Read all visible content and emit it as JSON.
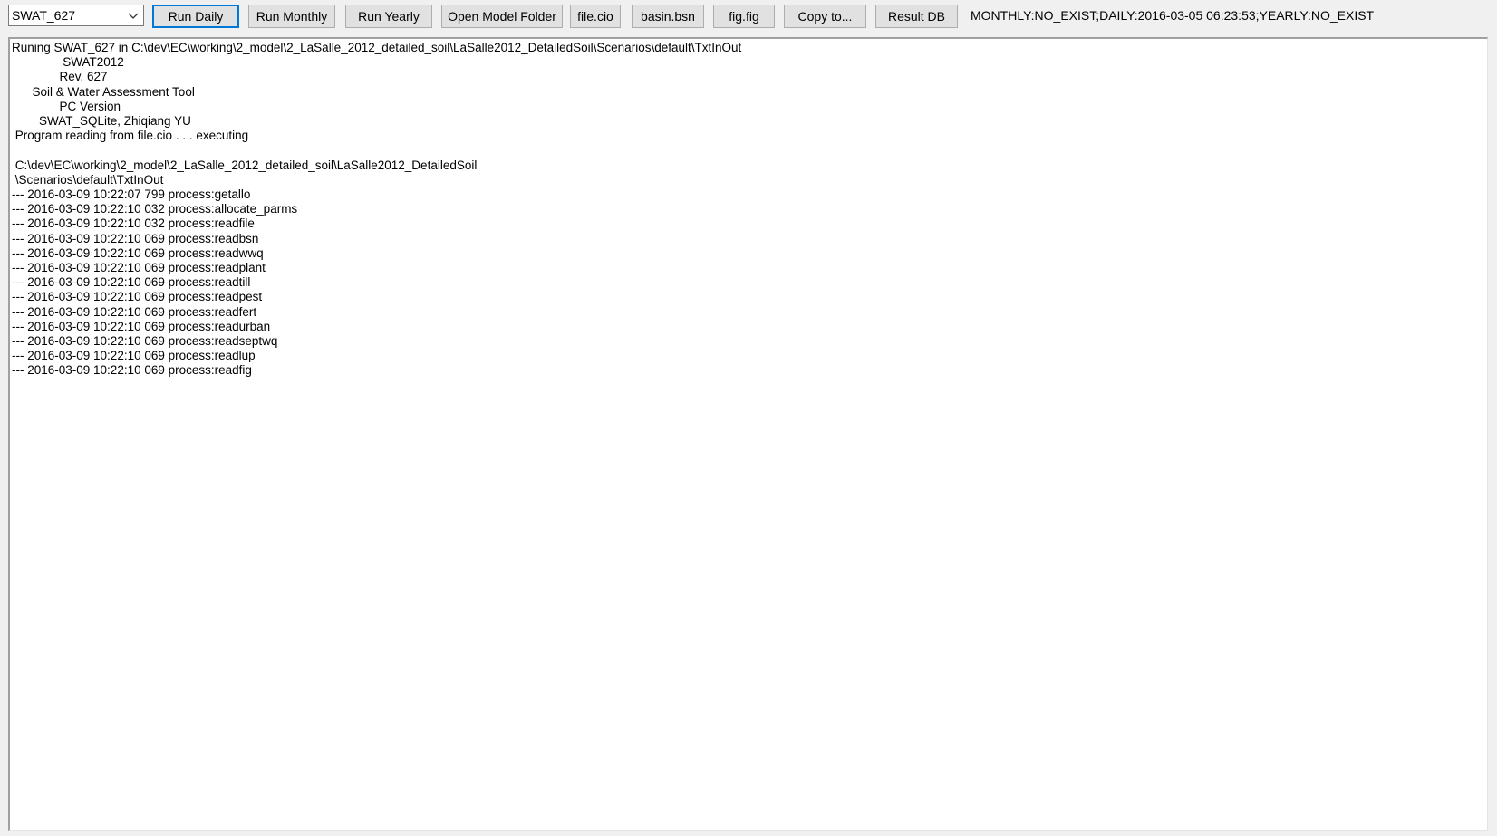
{
  "toolbar": {
    "version_select": {
      "value": "SWAT_627"
    },
    "buttons": {
      "run_daily": "Run Daily",
      "run_monthly": "Run Monthly",
      "run_yearly": "Run Yearly",
      "open_model_folder": "Open Model Folder",
      "file_cio": "file.cio",
      "basin_bsn": "basin.bsn",
      "fig_fig": "fig.fig",
      "copy_to": "Copy to...",
      "result_db": "Result DB"
    },
    "status_text": "MONTHLY:NO_EXIST;DAILY:2016-03-05 06:23:53;YEARLY:NO_EXIST"
  },
  "log": {
    "text": "Runing SWAT_627 in C:\\dev\\EC\\working\\2_model\\2_LaSalle_2012_detailed_soil\\LaSalle2012_DetailedSoil\\Scenarios\\default\\TxtInOut\n               SWAT2012\n              Rev. 627\n      Soil & Water Assessment Tool\n              PC Version\n        SWAT_SQLite, Zhiqiang YU\n Program reading from file.cio . . . executing\n\n C:\\dev\\EC\\working\\2_model\\2_LaSalle_2012_detailed_soil\\LaSalle2012_DetailedSoil\n \\Scenarios\\default\\TxtInOut\n--- 2016-03-09 10:22:07 799 process:getallo\n--- 2016-03-09 10:22:10 032 process:allocate_parms\n--- 2016-03-09 10:22:10 032 process:readfile\n--- 2016-03-09 10:22:10 069 process:readbsn\n--- 2016-03-09 10:22:10 069 process:readwwq\n--- 2016-03-09 10:22:10 069 process:readplant\n--- 2016-03-09 10:22:10 069 process:readtill\n--- 2016-03-09 10:22:10 069 process:readpest\n--- 2016-03-09 10:22:10 069 process:readfert\n--- 2016-03-09 10:22:10 069 process:readurban\n--- 2016-03-09 10:22:10 069 process:readseptwq\n--- 2016-03-09 10:22:10 069 process:readlup\n--- 2016-03-09 10:22:10 069 process:readfig"
  },
  "icons": {
    "dropdown": "chevron-down-icon"
  }
}
